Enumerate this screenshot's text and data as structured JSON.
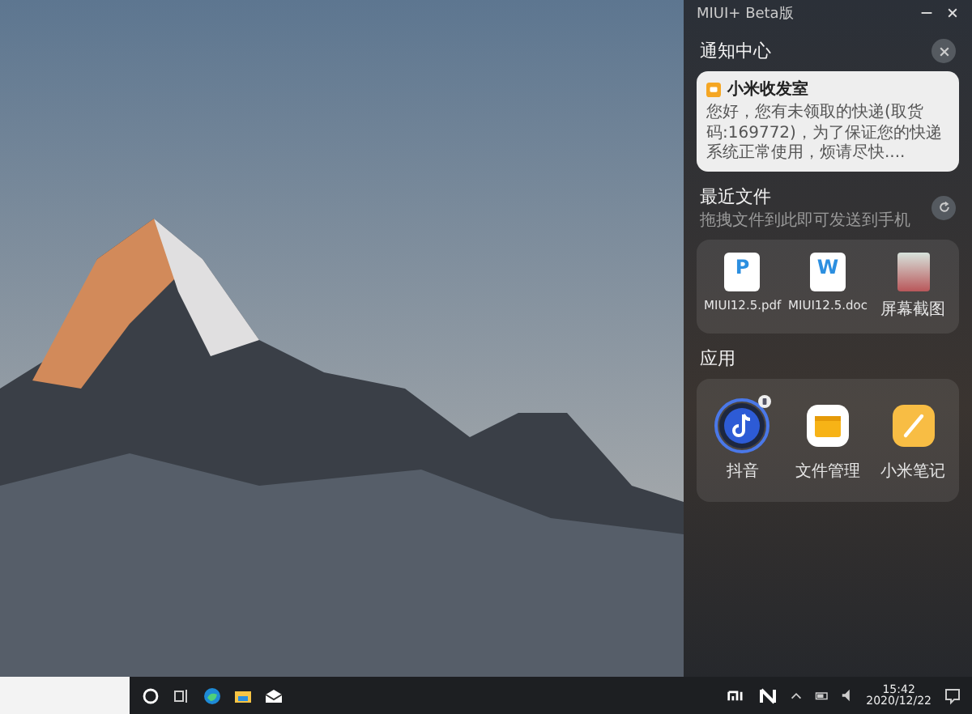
{
  "window": {
    "title": "MIUI+ Beta版"
  },
  "notification_center": {
    "title": "通知中心",
    "notifications": [
      {
        "app": "小米收发室",
        "body": "您好，您有未领取的快递(取货码:169772)，为了保证您的快递系统正常使用，烦请尽快...."
      }
    ]
  },
  "recent_files": {
    "title": "最近文件",
    "subtitle": "拖拽文件到此即可发送到手机",
    "files": [
      {
        "kind": "pdf",
        "badge": "P",
        "name": "MIUI12.5.pdf"
      },
      {
        "kind": "doc",
        "badge": "W",
        "name": "MIUI12.5.doc"
      },
      {
        "kind": "image",
        "name": "屏幕截图"
      }
    ]
  },
  "apps": {
    "title": "应用",
    "items": [
      {
        "kind": "music",
        "name": "抖音",
        "selected": true
      },
      {
        "kind": "folder",
        "name": "文件管理",
        "selected": false
      },
      {
        "kind": "notes",
        "name": "小米笔记",
        "selected": false
      }
    ]
  },
  "taskbar": {
    "time": "15:42",
    "date": "2020/12/22"
  }
}
